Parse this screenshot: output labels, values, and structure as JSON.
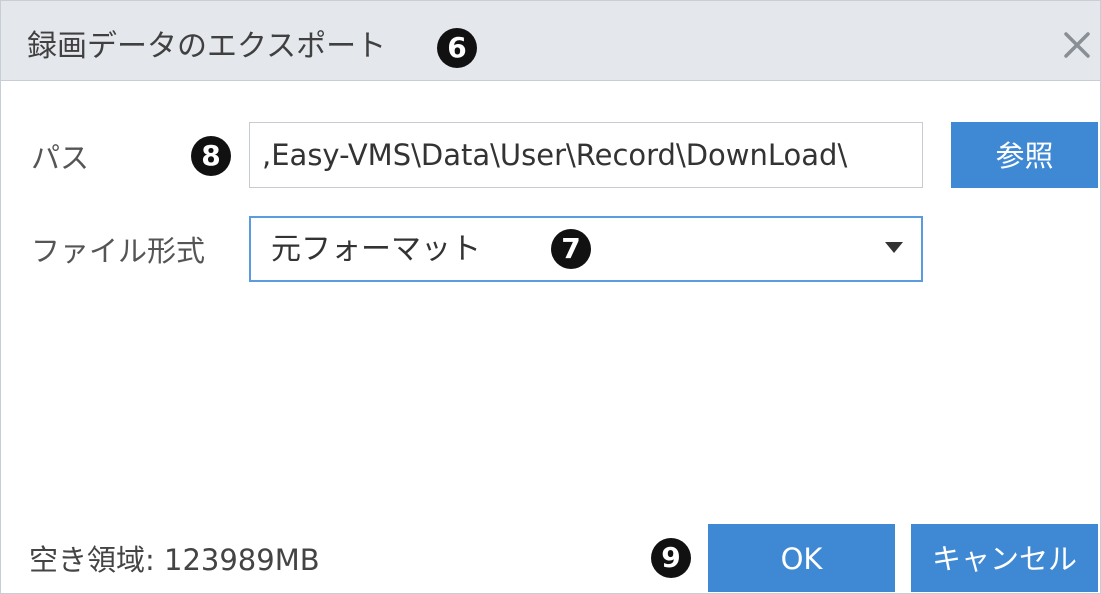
{
  "dialog": {
    "title": "録画データのエクスポート",
    "title_marker": "6",
    "close_icon": "close-icon"
  },
  "path": {
    "label": "パス",
    "marker": "8",
    "value": ",Easy-VMS\\Data\\User\\Record\\DownLoad\\",
    "browse_label": "参照"
  },
  "format": {
    "label": "ファイル形式",
    "selected": "元フォーマット",
    "marker": "7",
    "dropdown_icon": "caret-down-icon"
  },
  "footer": {
    "free_space_label": "空き領域:",
    "free_space_value": "123989MB",
    "ok_marker": "9",
    "ok_label": "OK",
    "cancel_label": "キャンセル"
  },
  "colors": {
    "titlebar_bg": "#e4e7ec",
    "primary_button": "#3f89d4",
    "select_focus_border": "#5b9be0",
    "marker_bg": "#111111"
  }
}
